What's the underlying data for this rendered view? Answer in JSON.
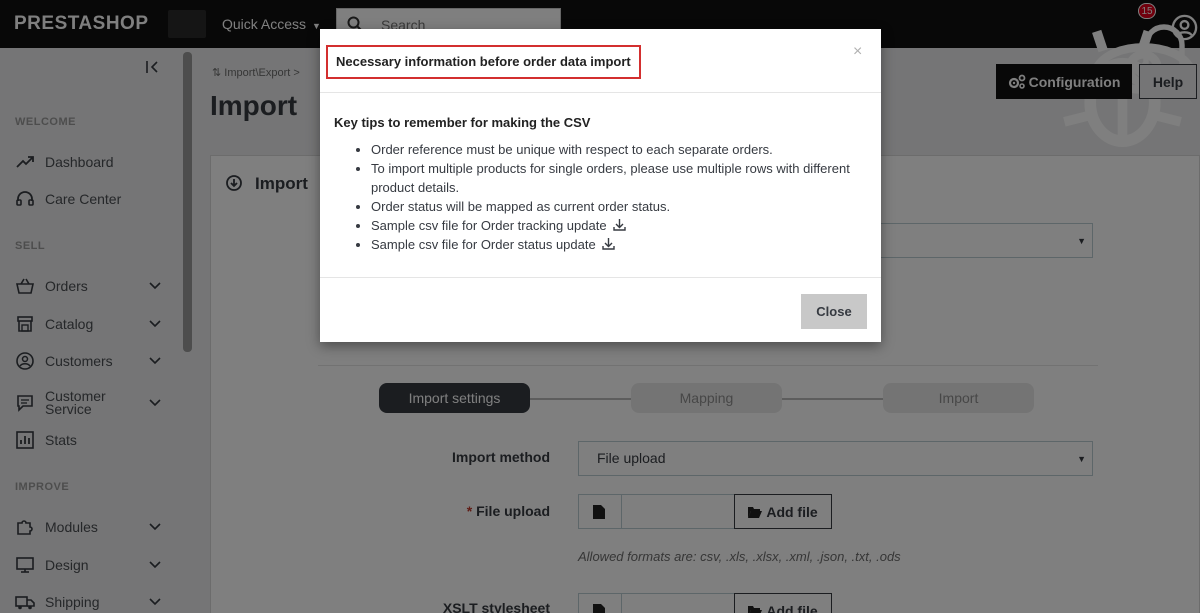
{
  "topbar": {
    "logo": "PRESTASHOP",
    "quick_access": "Quick Access",
    "search_placeholder": "Search",
    "notification_count": "15"
  },
  "sidebar": {
    "sections": {
      "welcome": "WELCOME",
      "sell": "SELL",
      "improve": "IMPROVE"
    },
    "items": [
      {
        "label": "Dashboard",
        "icon": "trending-up-icon"
      },
      {
        "label": "Care Center",
        "icon": "headset-icon"
      },
      {
        "label": "Orders",
        "icon": "basket-icon"
      },
      {
        "label": "Catalog",
        "icon": "store-icon"
      },
      {
        "label": "Customers",
        "icon": "user-circle-icon"
      },
      {
        "label": "Customer Service",
        "icon": "chat-icon"
      },
      {
        "label": "Stats",
        "icon": "bar-chart-icon"
      },
      {
        "label": "Modules",
        "icon": "puzzle-icon"
      },
      {
        "label": "Design",
        "icon": "monitor-icon"
      },
      {
        "label": "Shipping",
        "icon": "truck-icon"
      }
    ]
  },
  "page": {
    "breadcrumb": "Import\\Export",
    "title": "Import",
    "config_button": "Configuration",
    "help_button": "Help",
    "panel_title": "Import"
  },
  "steps": {
    "step1": "Import settings",
    "step2": "Mapping",
    "step3": "Import"
  },
  "form": {
    "import_method_label": "Import method",
    "import_method_value": "File upload",
    "file_upload_label": "File upload",
    "add_file": "Add file",
    "allowed_formats": "Allowed formats are: csv, .xls, .xlsx, .xml, .json, .txt, .ods",
    "xslt_label": "XSLT stylesheet"
  },
  "modal": {
    "title": "Necessary information before order data import",
    "close_x": "×",
    "tips_title": "Key tips to remember for making the CSV",
    "tips": [
      "Order reference must be unique with respect to each separate orders.",
      "To import multiple products for single orders, please use multiple rows with different product details.",
      "Order status will be mapped as current order status.",
      "Sample csv file for Order tracking update",
      "Sample csv file for Order status update"
    ],
    "close_button": "Close"
  },
  "colors": {
    "topbar": "#111111",
    "active_step": "#363a41",
    "highlight_border": "#d32f2f"
  }
}
